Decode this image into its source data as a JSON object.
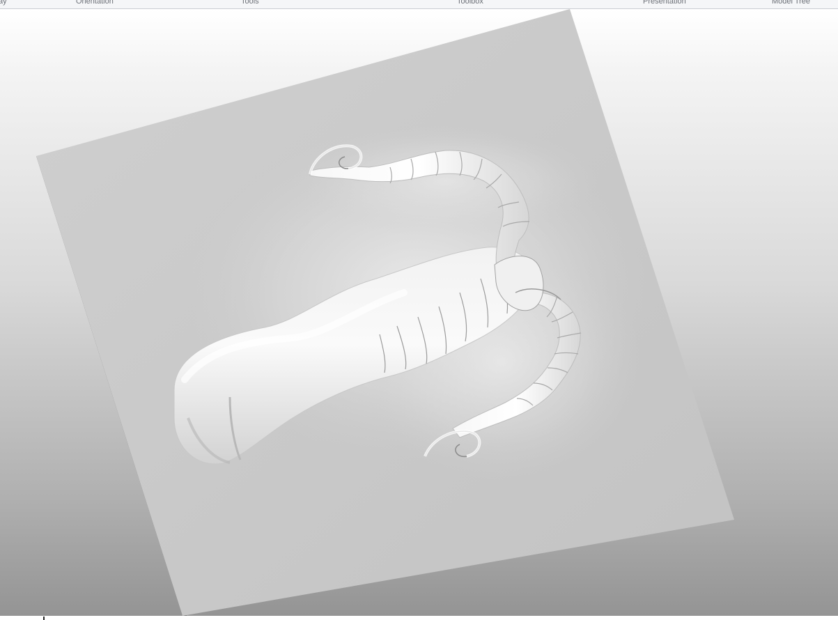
{
  "ribbon": {
    "groups": [
      "ay",
      "Orientation",
      "Tools",
      "Toolbox",
      "Presentation",
      "Model Tree"
    ]
  },
  "viewport": {
    "background_top": "#ffffff",
    "background_bottom": "#939393",
    "model": "relief-panel-with-scroll-ornament"
  }
}
